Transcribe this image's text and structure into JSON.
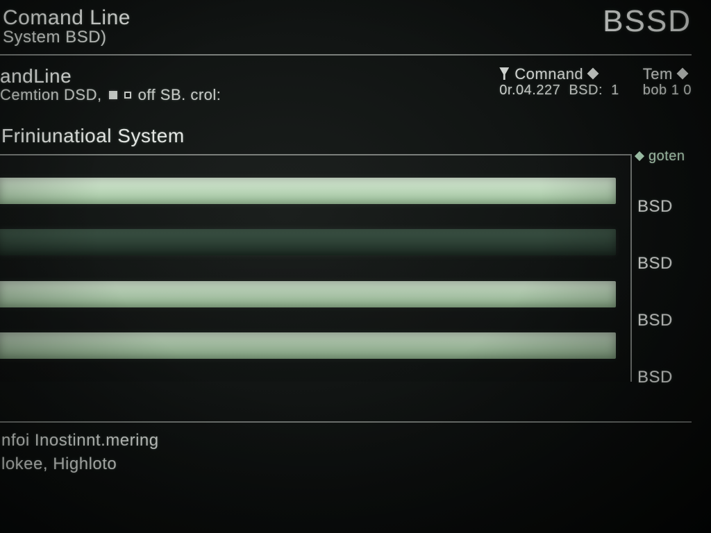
{
  "header": {
    "title_main": "Comand Line",
    "title_sub": "System BSD)",
    "brand": "BSSD"
  },
  "status": {
    "left_line1": "andLine",
    "left_line2_a": "Cemtion DSD,",
    "left_line2_b": "off SB. crol:",
    "cols": [
      {
        "hd": "Comnand",
        "val": "0r.04.227"
      },
      {
        "hd": "BSD:",
        "val": "1"
      },
      {
        "hd": "Tem",
        "val": "bob 1 0"
      }
    ]
  },
  "section_heading": "Friniunatioal System",
  "side": {
    "goten": "goten",
    "labels": [
      "BSD",
      "BSD",
      "BSD",
      "BSD"
    ]
  },
  "footer": {
    "line1": "nfoi Inostinnt.mering",
    "line2": "lokee, Highloto"
  },
  "chart_data": {
    "type": "bar",
    "orientation": "horizontal",
    "categories": [
      "BSD",
      "BSD",
      "BSD",
      "BSD"
    ],
    "values": [
      100,
      100,
      100,
      100
    ],
    "series_style": [
      "light",
      "dark",
      "light",
      "light"
    ],
    "title": "Friniunatioal System",
    "xlabel": "",
    "ylabel": "",
    "xlim": [
      0,
      100
    ]
  }
}
